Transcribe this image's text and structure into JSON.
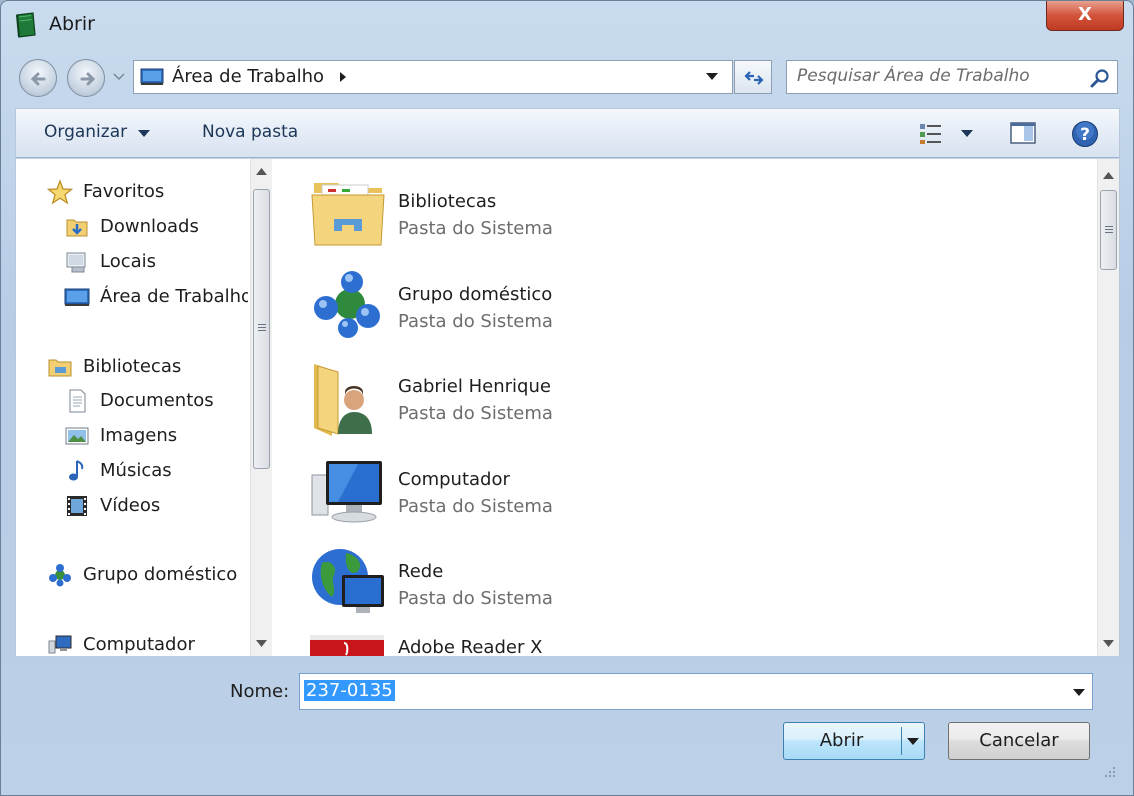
{
  "window": {
    "title": "Abrir",
    "close_label": "X"
  },
  "address": {
    "location": "Área de Trabalho"
  },
  "search": {
    "placeholder": "Pesquisar Área de Trabalho"
  },
  "toolbar": {
    "organize_label": "Organizar",
    "new_folder_label": "Nova pasta"
  },
  "sidebar": {
    "items": [
      {
        "label": "Favoritos",
        "icon": "star-icon"
      },
      {
        "label": "Downloads",
        "icon": "downloads-folder-icon"
      },
      {
        "label": "Locais",
        "icon": "recent-places-icon"
      },
      {
        "label": "Área de Trabalho",
        "icon": "desktop-icon"
      },
      {
        "label": "Bibliotecas",
        "icon": "libraries-icon"
      },
      {
        "label": "Documentos",
        "icon": "document-icon"
      },
      {
        "label": "Imagens",
        "icon": "pictures-icon"
      },
      {
        "label": "Músicas",
        "icon": "music-note-icon"
      },
      {
        "label": "Vídeos",
        "icon": "film-icon"
      },
      {
        "label": "Grupo doméstico",
        "icon": "homegroup-icon"
      },
      {
        "label": "Computador",
        "icon": "computer-icon"
      }
    ]
  },
  "files": [
    {
      "name": "Bibliotecas",
      "type": "Pasta do Sistema",
      "icon": "libraries-folder-icon"
    },
    {
      "name": "Grupo doméstico",
      "type": "Pasta do Sistema",
      "icon": "homegroup-icon"
    },
    {
      "name": "Gabriel Henrique",
      "type": "Pasta do Sistema",
      "icon": "user-folder-icon"
    },
    {
      "name": "Computador",
      "type": "Pasta do Sistema",
      "icon": "computer-icon"
    },
    {
      "name": "Rede",
      "type": "Pasta do Sistema",
      "icon": "network-globe-icon"
    },
    {
      "name": "Adobe Reader X",
      "type": "",
      "icon": "adobe-reader-icon"
    }
  ],
  "footer": {
    "name_label": "Nome:",
    "file_name": "237-0135",
    "open_label": "Abrir",
    "cancel_label": "Cancelar"
  },
  "colors": {
    "accent": "#3399ff",
    "selection": "#3399ff",
    "close_button": "#c13a22"
  }
}
